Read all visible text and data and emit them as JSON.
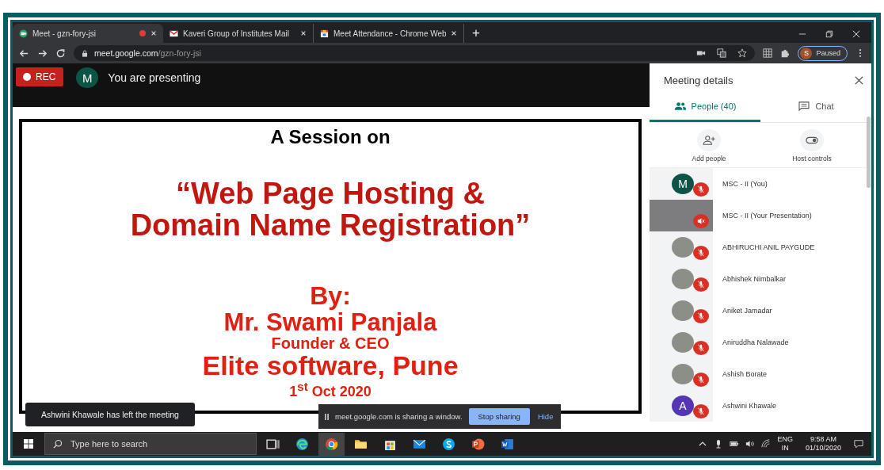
{
  "browser": {
    "tabs": [
      {
        "title": "Meet - gzn-fory-jsi",
        "selected": true,
        "recording": true,
        "kind": "meet"
      },
      {
        "title": "Kaveri Group of Institutes Mail",
        "selected": false,
        "recording": false,
        "kind": "mail"
      },
      {
        "title": "Meet Attendance - Chrome Web",
        "selected": false,
        "recording": false,
        "kind": "store"
      }
    ],
    "new_tab": "+",
    "address": {
      "host": "meet.google.com",
      "path": "/gzn-fory-jsi"
    },
    "profile": {
      "initial": "S",
      "status": "Paused"
    }
  },
  "meet": {
    "rec_label": "REC",
    "presenter_initial": "M",
    "presenting_text": "You are presenting",
    "slide": [
      {
        "text": "A Session on",
        "kind": "heading"
      },
      {
        "text": "“Web Page Hosting &",
        "kind": "title"
      },
      {
        "text": "Domain Name Registration”",
        "kind": "title"
      },
      {
        "text": "By:",
        "kind": "byline"
      },
      {
        "text": "Mr. Swami Panjala",
        "kind": "name"
      },
      {
        "text": "Founder & CEO",
        "kind": "role"
      },
      {
        "text": "Elite software, Pune",
        "kind": "company"
      },
      {
        "text": "1$^{st}$ Oct 2020",
        "kind": "date"
      }
    ],
    "toast": "Ashwini Khawale has left the meeting",
    "share_bar": {
      "message": "meet.google.com is sharing a window.",
      "stop": "Stop sharing",
      "hide": "Hide"
    }
  },
  "panel": {
    "title": "Meeting details",
    "tabs": [
      {
        "label": "People (40)",
        "selected": true,
        "kind": "people"
      },
      {
        "label": "Chat",
        "selected": false,
        "kind": "chat"
      }
    ],
    "actions": [
      {
        "label": "Add people",
        "kind": "add"
      },
      {
        "label": "Host controls",
        "kind": "host"
      }
    ],
    "participants": [
      {
        "name": "MSC - II (You)",
        "kind": "letter",
        "initial": "M",
        "color": "#0d5446",
        "muted": true
      },
      {
        "name": "MSC - II (Your Presentation)",
        "kind": "presentation",
        "muted": true
      },
      {
        "name": "ABHIRUCHI ANIL PAYGUDE",
        "kind": "photo",
        "muted": true
      },
      {
        "name": "Abhishek Nimbalkar",
        "kind": "photo",
        "muted": true
      },
      {
        "name": "Aniket Jamadar",
        "kind": "photo",
        "muted": true
      },
      {
        "name": "Aniruddha Nalawade",
        "kind": "photo",
        "muted": true
      },
      {
        "name": "Ashish Borate",
        "kind": "photo",
        "muted": true
      },
      {
        "name": "Ashwini Khawale",
        "kind": "letter",
        "initial": "A",
        "color": "#5335b5",
        "muted": true
      }
    ]
  },
  "taskbar": {
    "search_placeholder": "Type here to search",
    "language": "ENG",
    "region": "IN",
    "time": "9:58 AM",
    "date": "01/10/2020"
  }
}
